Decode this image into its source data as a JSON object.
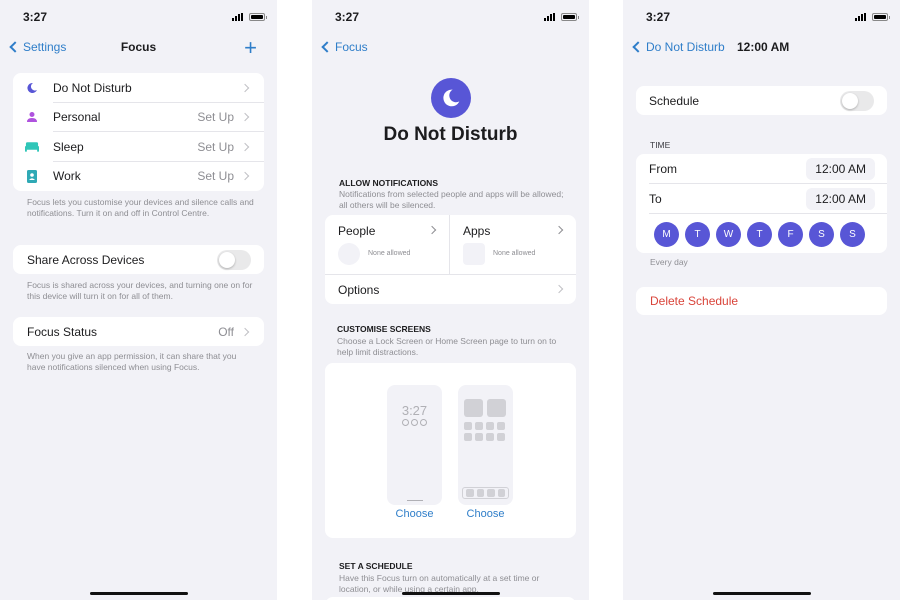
{
  "status_time": "3:27",
  "screen1": {
    "back_label": "Settings",
    "title": "Focus",
    "focus_items": [
      {
        "label": "Do Not Disturb",
        "value": "",
        "icon": "moon-icon",
        "color": "#5856d6"
      },
      {
        "label": "Personal",
        "value": "Set Up",
        "icon": "person-icon",
        "color": "#af52de"
      },
      {
        "label": "Sleep",
        "value": "Set Up",
        "icon": "bed-icon",
        "color": "#30c6b8"
      },
      {
        "label": "Work",
        "value": "Set Up",
        "icon": "badge-icon",
        "color": "#2fa9b5"
      }
    ],
    "focus_note": "Focus lets you customise your devices and silence calls and notifications. Turn it on and off in Control Centre.",
    "share_label": "Share Across Devices",
    "share_on": false,
    "share_note": "Focus is shared across your devices, and turning one on for this device will turn it on for all of them.",
    "status_label": "Focus Status",
    "status_value": "Off",
    "status_note": "When you give an app permission, it can share that you have notifications silenced when using Focus."
  },
  "screen2": {
    "back_label": "Focus",
    "title": "Do Not Disturb",
    "allow_header": "ALLOW NOTIFICATIONS",
    "allow_note": "Notifications from selected people and apps will be allowed; all others will be silenced.",
    "people_label": "People",
    "people_sub": "None allowed",
    "apps_label": "Apps",
    "apps_sub": "None allowed",
    "options_label": "Options",
    "screens_header": "CUSTOMISE SCREENS",
    "screens_note": "Choose a Lock Screen or Home Screen page to turn on to help limit distractions.",
    "lock_time": "3:27",
    "choose_lock": "Choose",
    "choose_home": "Choose",
    "schedule_header": "SET A SCHEDULE",
    "schedule_note": "Have this Focus turn on automatically at a set time or location, or while using a certain app."
  },
  "screen3": {
    "back_label": "Do Not Disturb",
    "title": "12:00 AM",
    "schedule_label": "Schedule",
    "schedule_on": false,
    "time_header": "TIME",
    "from_label": "From",
    "from_value": "12:00 AM",
    "to_label": "To",
    "to_value": "12:00 AM",
    "days": [
      "M",
      "T",
      "W",
      "T",
      "F",
      "S",
      "S"
    ],
    "days_note": "Every day",
    "delete_label": "Delete Schedule",
    "accent": "#5856d6",
    "destructive": "#d9443a"
  }
}
